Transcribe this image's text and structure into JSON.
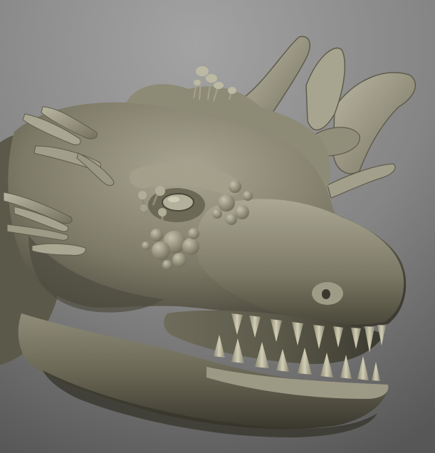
{
  "scene": {
    "subject": "sculpted-creature-head",
    "material": "matte-clay",
    "colors": {
      "background_light": "#9a9a9a",
      "background_dark": "#555555",
      "clay_light": "#b7b49f",
      "clay_mid": "#8a8774",
      "clay_dark": "#4b493c",
      "clay_deep": "#2f2e26",
      "tooth": "#cfcbb3"
    }
  }
}
